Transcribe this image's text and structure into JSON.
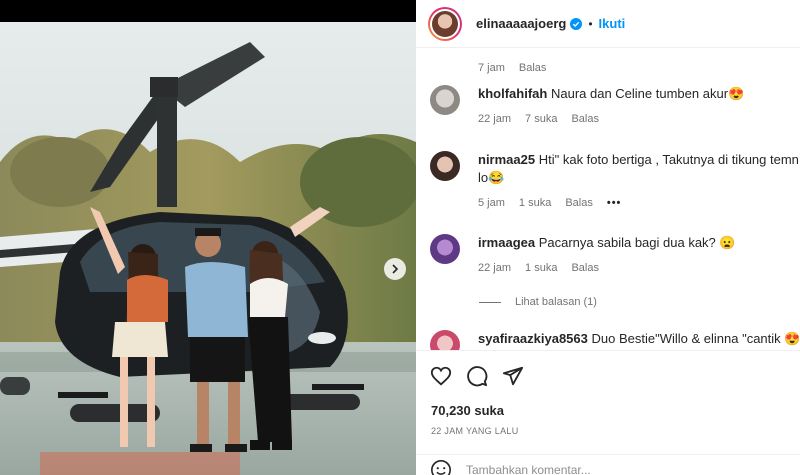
{
  "post": {
    "username": "elinaaaaajoerg",
    "follow_label": "Ikuti",
    "separator": "•",
    "image_alt": "Tiga orang berpose di depan helikopter"
  },
  "comments": [
    {
      "partial": true,
      "time": "7 jam",
      "reply": "Balas"
    },
    {
      "username": "kholfahifah",
      "text": "Naura dan Celine tumben akur",
      "emoji": "😍",
      "time": "22 jam",
      "likes": "7 suka",
      "reply": "Balas"
    },
    {
      "username": "nirmaa25",
      "text": "Hti\" kak foto bertiga , Takutnya di tikung temn sndri",
      "text_line2": "lo",
      "emoji": "😂",
      "time": "5 jam",
      "likes": "1 suka",
      "reply": "Balas",
      "more": "•••"
    },
    {
      "username": "irmaagea",
      "text": "Pacarnya sabila bagi dua kak?",
      "emoji": "😦",
      "time": "22 jam",
      "likes": "1 suka",
      "reply": "Balas",
      "view_replies": "Lihat balasan (1)"
    },
    {
      "username": "syafiraazkiya8563",
      "text": "Duo Bestie\"Willo & elinna \"cantik",
      "emoji": "😍😍"
    }
  ],
  "actions": {
    "likes": "70,230 suka",
    "time": "22 JAM YANG LALU",
    "comment_placeholder": "Tambahkan komentar..."
  },
  "icons": {
    "verified": "verified-badge-icon",
    "like": "heart-icon",
    "comment": "comment-bubble-icon",
    "share": "paper-plane-icon",
    "emoji": "emoji-smile-icon",
    "next": "chevron-right-icon"
  },
  "colors": {
    "accent": "#0095f6",
    "text": "#262626",
    "muted": "#737373"
  }
}
